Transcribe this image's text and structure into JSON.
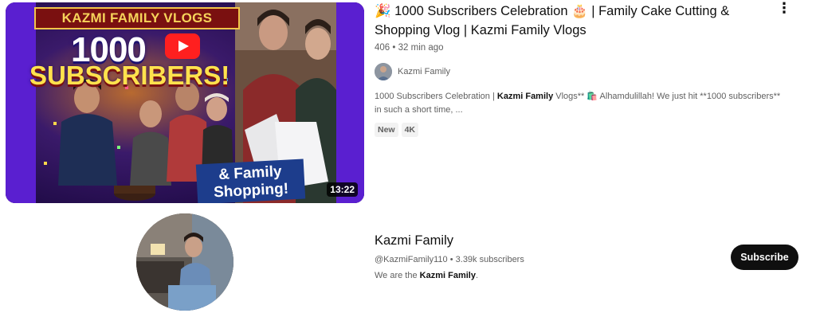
{
  "video": {
    "thumbnail": {
      "banner": "KAZMI FAMILY VLOGS",
      "big_text": "1000",
      "sub_text": "SUBSCRIBERS!",
      "shopping_text": "& Family Shopping!",
      "duration": "13:22"
    },
    "title": "🎉 1000 Subscribers Celebration 🎂 | Family Cake Cutting & Shopping Vlog | Kazmi Family Vlogs",
    "views": "406",
    "separator": "•",
    "age": "32 min ago",
    "channel_name": "Kazmi Family",
    "description_plain_1": "1000 Subscribers Celebration | ",
    "description_bold": "Kazmi Family",
    "description_plain_2": " Vlogs** 🛍️ Alhamdulillah! We just hit **1000 subscribers** in such a short time, ...",
    "badges": [
      "New",
      "4K"
    ],
    "more_icon": "⋮"
  },
  "channel": {
    "name": "Kazmi Family",
    "handle": "@KazmiFamily110",
    "separator": "•",
    "subscribers": "3.39k subscribers",
    "description_prefix": "We are the ",
    "description_bold": "Kazmi Family",
    "description_suffix": ".",
    "subscribe_label": "Subscribe"
  },
  "colors": {
    "thumb_bg": "#5a1fd0",
    "subscribe_bg": "#0f0f0f",
    "muted_text": "#606060"
  }
}
